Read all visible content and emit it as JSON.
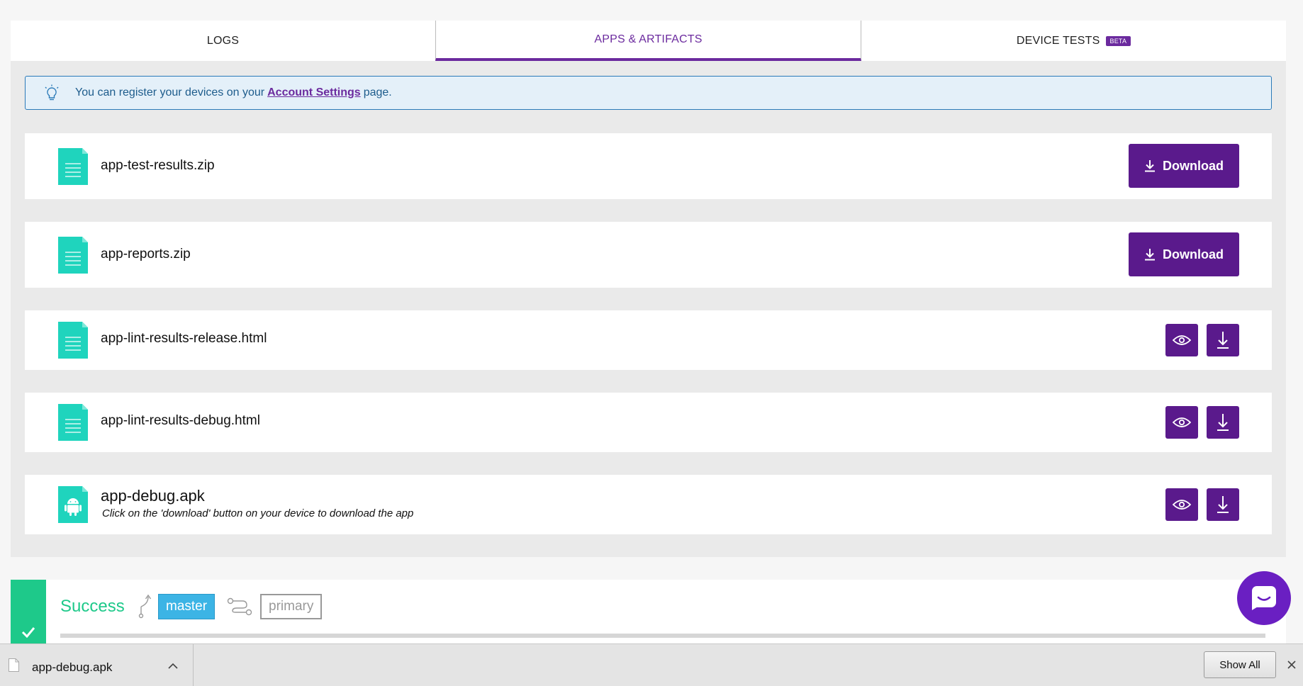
{
  "tabs": [
    {
      "label": "LOGS"
    },
    {
      "label": "APPS & ARTIFACTS"
    },
    {
      "label": "DEVICE TESTS",
      "badge": "BETA"
    }
  ],
  "info": {
    "prefix": "You can register your devices on your",
    "link": "Account Settings",
    "suffix": "page."
  },
  "artifacts": [
    {
      "name": "app-test-results.zip",
      "icon": "document-icon",
      "action": "Download"
    },
    {
      "name": "app-reports.zip",
      "icon": "document-icon",
      "action": "Download"
    },
    {
      "name": "app-lint-results-release.html",
      "icon": "document-icon"
    },
    {
      "name": "app-lint-results-debug.html",
      "icon": "document-icon"
    },
    {
      "name": "app-debug.apk",
      "icon": "android-icon",
      "note": "Click on the 'download' button on your device to download the app"
    }
  ],
  "build": {
    "status": "Success",
    "branch": "master",
    "workflow": "primary"
  },
  "downloads_bar": {
    "file": "app-debug.apk",
    "show_all": "Show All"
  },
  "colors": {
    "accent": "#5a1a8c",
    "file_icon": "#1fd4bd",
    "success": "#1ec98a",
    "branch": "#3cb4e5"
  }
}
